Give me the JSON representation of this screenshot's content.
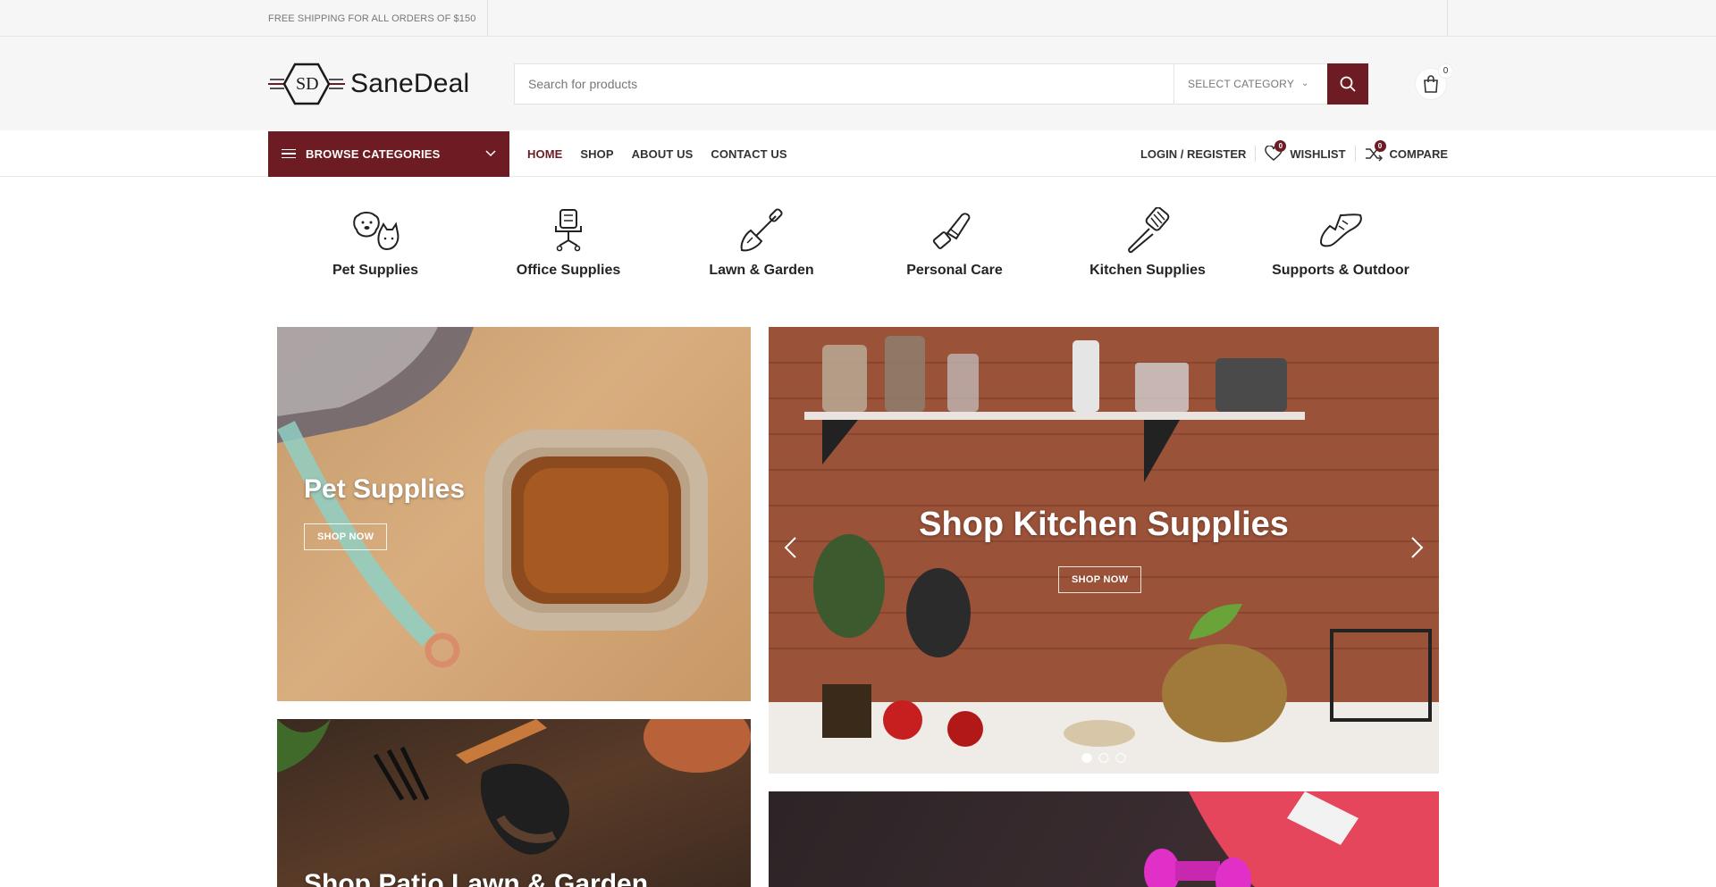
{
  "topbar": {
    "promo": "FREE SHIPPING FOR ALL ORDERS OF $150"
  },
  "header": {
    "logo_text": "SaneDeal",
    "logo_mark": "SD",
    "search_placeholder": "Search for products",
    "category_select": "SELECT CATEGORY",
    "cart_count": "0"
  },
  "nav": {
    "browse_label": "BROWSE CATEGORIES",
    "menu": [
      "HOME",
      "SHOP",
      "ABOUT US",
      "CONTACT US"
    ],
    "login": "LOGIN / REGISTER",
    "wishlist": "WISHLIST",
    "wishlist_count": "0",
    "compare": "COMPARE",
    "compare_count": "0"
  },
  "categories": [
    {
      "name": "Pet Supplies",
      "icon": "pet-icon"
    },
    {
      "name": "Office Supplies",
      "icon": "office-chair-icon"
    },
    {
      "name": "Lawn & Garden",
      "icon": "trowel-icon"
    },
    {
      "name": "Personal Care",
      "icon": "lipstick-icon"
    },
    {
      "name": "Kitchen Supplies",
      "icon": "spatula-icon"
    },
    {
      "name": "Supports & Outdoor",
      "icon": "shoe-icon"
    }
  ],
  "banners": {
    "pet": {
      "title": "Pet Supplies",
      "button": "SHOP NOW"
    },
    "kitchen": {
      "title": "Shop Kitchen Supplies",
      "button": "SHOP NOW"
    },
    "lawn": {
      "title": "Shop Patio Lawn & Garden"
    }
  },
  "colors": {
    "brand": "#6e1c23",
    "topbar_bg": "#f6f6f6"
  }
}
